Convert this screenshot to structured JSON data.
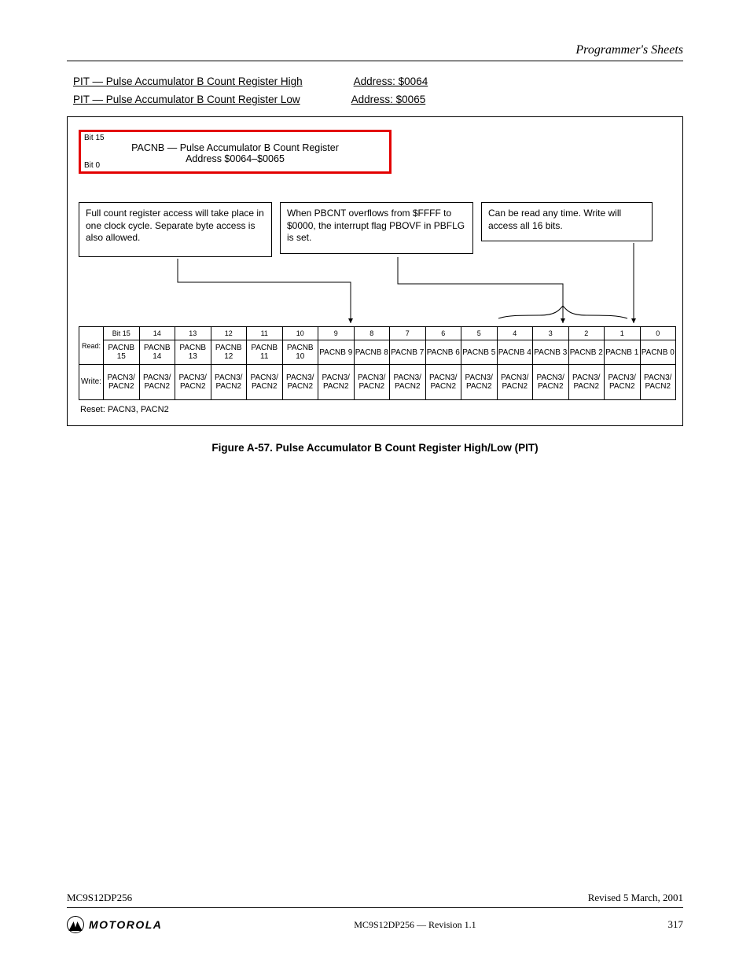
{
  "header": {
    "running": "Programmer's Sheets"
  },
  "reg_rows": [
    {
      "name_label": "PIT — Pulse Accumulator B Count Register High",
      "addr_label": "Address: $0064"
    },
    {
      "name_label": "PIT — Pulse Accumulator B Count Register Low",
      "addr_label": "Address: $0065"
    }
  ],
  "redbox": {
    "bit_hi": "Bit 15",
    "bit_lo": "Bit 0",
    "line1": "PACNB — Pulse Accumulator B Count Register",
    "line2": "Address $0064–$0065"
  },
  "desc": {
    "a": "Full count register access will take place in one clock cycle. Separate byte access is also allowed.",
    "b": "When PBCNT overflows from $FFFF to $0000, the interrupt flag PBOVF in PBFLG is set.",
    "c": "Can be read any time. Write will access all 16 bits."
  },
  "bit_table": {
    "side_read": "Read:",
    "side_write": "Write:",
    "bits": [
      15,
      14,
      13,
      12,
      11,
      10,
      9,
      8,
      7,
      6,
      5,
      4,
      3,
      2,
      1,
      0
    ],
    "names": [
      "PACNB 15",
      "PACNB 14",
      "PACNB 13",
      "PACNB 12",
      "PACNB 11",
      "PACNB 10",
      "PACNB 9",
      "PACNB 8",
      "PACNB 7",
      "PACNB 6",
      "PACNB 5",
      "PACNB 4",
      "PACNB 3",
      "PACNB 2",
      "PACNB 1",
      "PACNB 0"
    ],
    "rw": [
      "PACN3/ PACN2",
      "PACN3/ PACN2",
      "PACN3/ PACN2",
      "PACN3/ PACN2",
      "PACN3/ PACN2",
      "PACN3/ PACN2",
      "PACN3/ PACN2",
      "PACN3/ PACN2",
      "PACN3/ PACN2",
      "PACN3/ PACN2",
      "PACN3/ PACN2",
      "PACN3/ PACN2",
      "PACN3/ PACN2",
      "PACN3/ PACN2",
      "PACN3/ PACN2",
      "PACN3/ PACN2"
    ]
  },
  "reset_line": "Reset: PACN3, PACN2",
  "figure_caption": "Figure A-57.  Pulse Accumulator B Count Register High/Low (PIT)",
  "footer": {
    "doc_id": "MC9S12DP256",
    "rev": "Revised 5 March, 2001",
    "center": "MC9S12DP256 — Revision 1.1",
    "page": "317"
  }
}
